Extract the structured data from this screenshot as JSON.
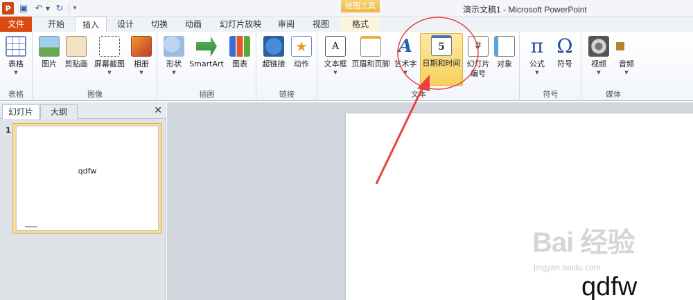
{
  "titlebar": {
    "logo_letter": "P",
    "window_title": "演示文稿1 - Microsoft PowerPoint",
    "contextual_header": "绘图工具"
  },
  "tabs": {
    "file": "文件",
    "home": "开始",
    "insert": "插入",
    "design": "设计",
    "transitions": "切换",
    "animations": "动画",
    "slideshow": "幻灯片放映",
    "review": "审阅",
    "view": "视图",
    "format": "格式",
    "active": "插入"
  },
  "ribbon": {
    "groups": {
      "tables": "表格",
      "images": "图像",
      "illustrations": "插图",
      "links": "链接",
      "text": "文本",
      "symbols": "符号",
      "media": "媒体"
    },
    "buttons": {
      "table": "表格",
      "picture": "图片",
      "clipart": "剪贴画",
      "screenshot": "屏幕截图",
      "album": "相册",
      "shapes": "形状",
      "smartart": "SmartArt",
      "chart": "图表",
      "hyperlink": "超链接",
      "action": "动作",
      "textbox": "文本框",
      "headerfooter": "页眉和页脚",
      "wordart": "艺术字",
      "datetime": "日期和时间",
      "slidenum_line1": "幻灯片",
      "slidenum_line2": "编号",
      "object": "对象",
      "equation": "公式",
      "symbol": "符号",
      "video": "视频",
      "audio": "音频"
    },
    "icon_glyphs": {
      "wordart": "A",
      "datetime": "5",
      "slidenum": "#",
      "equation": "π",
      "symbol": "Ω"
    },
    "highlighted_button": "日期和时间"
  },
  "panel": {
    "tab_slides": "幻灯片",
    "tab_outline": "大纲",
    "close_glyph": "✕",
    "slide_number": "1",
    "thumbnail_text": "qdfw"
  },
  "slide": {
    "text": "qdfw"
  },
  "watermark": {
    "main": "Bai 经验",
    "sub": "jingyan.baidu.com"
  },
  "colors": {
    "file_tab": "#d94b12",
    "highlight": "#f7cf5c",
    "annotation": "#e8413f",
    "accent_blue": "#2b5fa3"
  }
}
